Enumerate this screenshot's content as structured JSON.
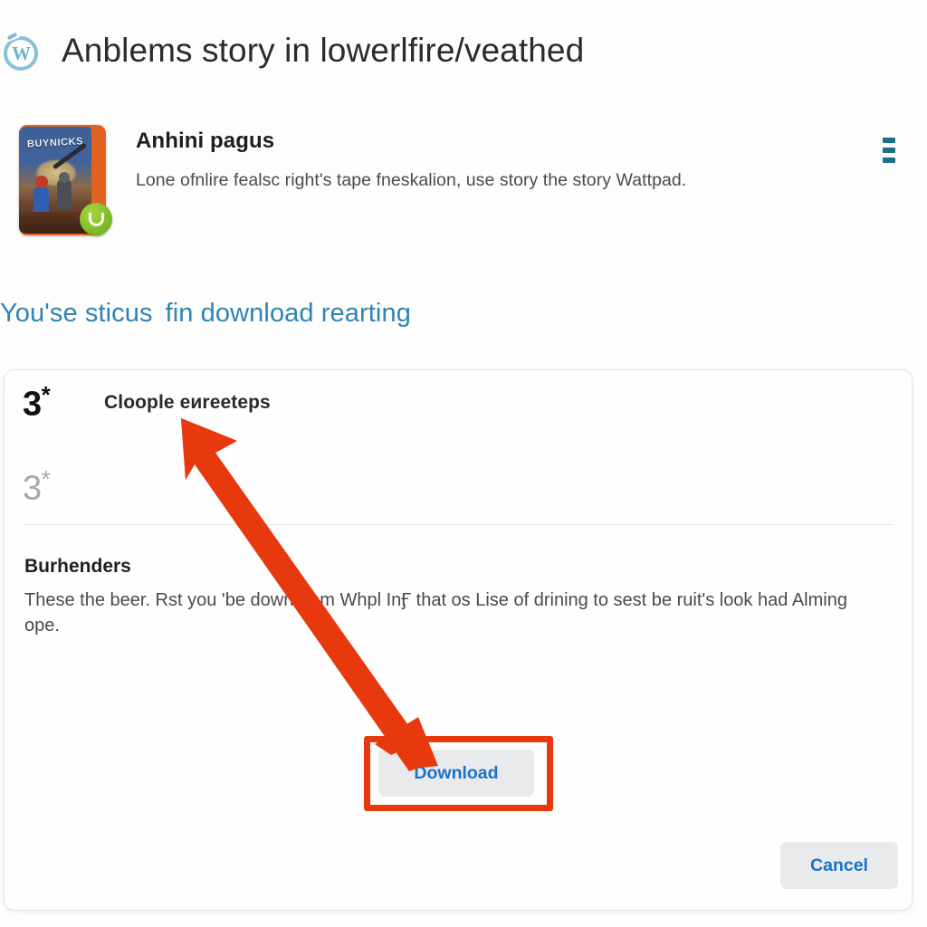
{
  "header": {
    "logo_icon": "wattpad-w-circle-icon",
    "title": "Anblems story in lowerlfire/veathed"
  },
  "app": {
    "thumbnail_icon": "book-cover-thumbnail",
    "thumbnail_cover_title": "BUYNICKS",
    "badge_icon": "green-check-badge",
    "name": "Anhini pagus",
    "description": "Lone ofnlire fealsc right's tape fneskalion, use story the story Wattpad.",
    "menu_icon": "more-vertical-icon"
  },
  "link": {
    "text_part1": "You'se sticus",
    "text_part2": "fin download rearting",
    "color": "#2f83b5"
  },
  "card": {
    "version_primary": "3",
    "version_primary_star": "*",
    "version_secondary": "3",
    "version_secondary_star": "*",
    "heading": "Cloople еиreeteps",
    "section_title": "Burhenders",
    "section_body": "These the beer. Rst you 'be down from Whpl InӺ that os Lise of drining to sest be ruit's look had Alming ope."
  },
  "buttons": {
    "download_label": "Download",
    "cancel_label": "Cancel"
  },
  "annotation": {
    "arrow_color": "#e8380d",
    "highlight_color": "#e8380d",
    "arrow_icon": "double-headed-arrow-annotation",
    "highlight_icon": "red-highlight-rectangle"
  }
}
